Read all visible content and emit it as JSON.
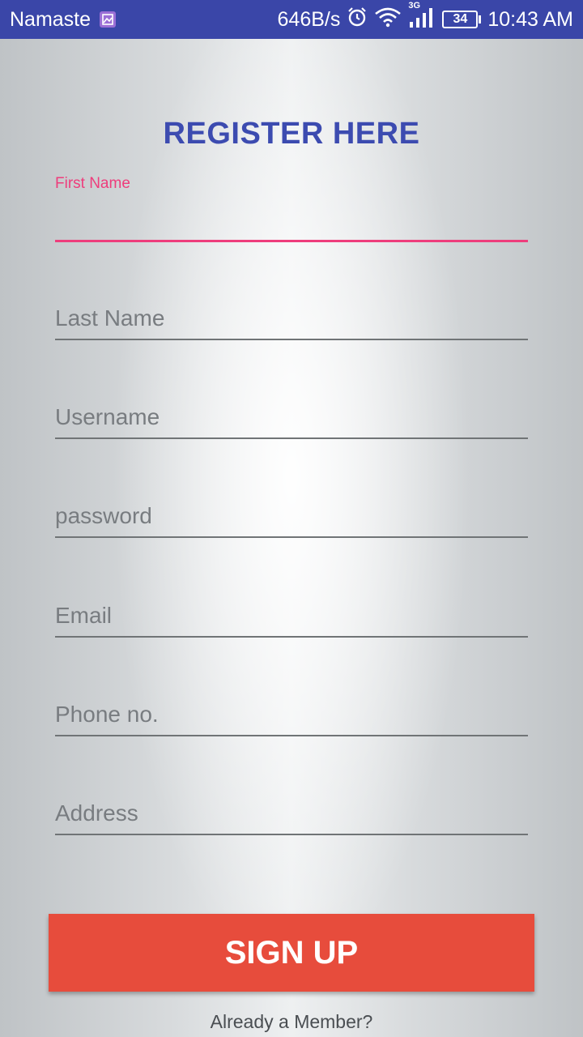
{
  "status_bar": {
    "app_name": "Namaste",
    "net_speed": "646B/s",
    "network_type": "3G",
    "battery": "34",
    "time": "10:43 AM",
    "bg_color": "#3a46a8"
  },
  "form": {
    "title": "REGISTER HERE",
    "title_color": "#3c4bb0",
    "accent_color": "#ee3d7c",
    "fields": [
      {
        "name": "first-name",
        "label": "First Name",
        "value": "",
        "active": true
      },
      {
        "name": "last-name",
        "placeholder": "Last Name",
        "value": ""
      },
      {
        "name": "username",
        "placeholder": "Username",
        "value": ""
      },
      {
        "name": "password",
        "placeholder": "password",
        "value": ""
      },
      {
        "name": "email",
        "placeholder": "Email",
        "value": ""
      },
      {
        "name": "phone",
        "placeholder": "Phone no.",
        "value": ""
      },
      {
        "name": "address",
        "placeholder": "Address",
        "value": ""
      }
    ],
    "signup_label": "SIGN UP",
    "signup_color": "#e74c3c",
    "member_link": "Already a Member?"
  }
}
